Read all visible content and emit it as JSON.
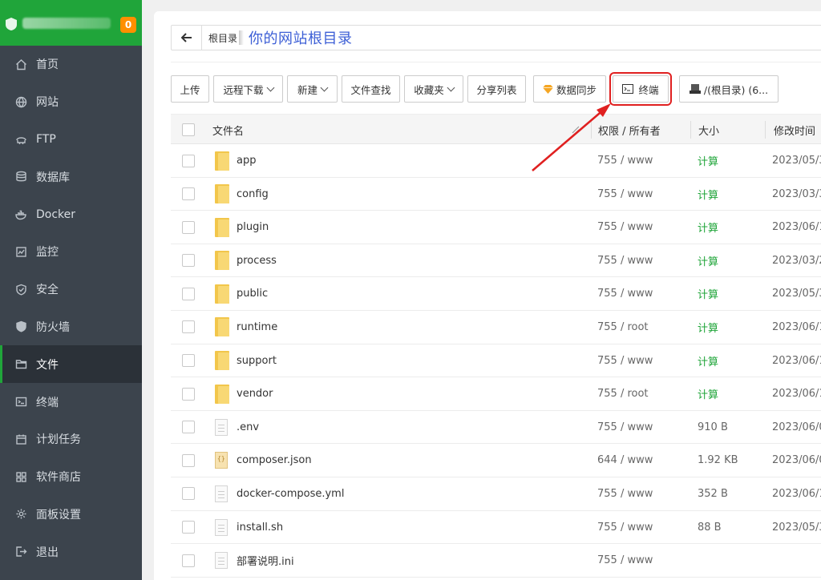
{
  "sidebar": {
    "badge": "0",
    "items": [
      {
        "label": "首页",
        "icon": "home-icon"
      },
      {
        "label": "网站",
        "icon": "globe-icon"
      },
      {
        "label": "FTP",
        "icon": "ftp-icon"
      },
      {
        "label": "数据库",
        "icon": "database-icon"
      },
      {
        "label": "Docker",
        "icon": "docker-icon"
      },
      {
        "label": "监控",
        "icon": "monitor-icon"
      },
      {
        "label": "安全",
        "icon": "shield-icon"
      },
      {
        "label": "防火墙",
        "icon": "firewall-icon"
      },
      {
        "label": "文件",
        "icon": "folder-icon",
        "active": true
      },
      {
        "label": "终端",
        "icon": "terminal-icon"
      },
      {
        "label": "计划任务",
        "icon": "calendar-icon"
      },
      {
        "label": "软件商店",
        "icon": "apps-icon"
      },
      {
        "label": "面板设置",
        "icon": "gear-icon"
      },
      {
        "label": "退出",
        "icon": "logout-icon"
      }
    ]
  },
  "path": {
    "crumb": "根目录",
    "title": "你的网站根目录"
  },
  "toolbar": {
    "upload": "上传",
    "remote_download": "远程下载",
    "new": "新建",
    "file_search": "文件查找",
    "favorites": "收藏夹",
    "share_list": "分享列表",
    "data_sync": "数据同步",
    "terminal": "终端",
    "disk": "/(根目录) (6..."
  },
  "table": {
    "headers": {
      "name": "文件名",
      "perm": "权限 / 所有者",
      "size": "大小",
      "mtime": "修改时间"
    },
    "rows": [
      {
        "name": "app",
        "type": "folder",
        "perm": "755 / www",
        "size": "计算",
        "calc": true,
        "mtime": "2023/05/3"
      },
      {
        "name": "config",
        "type": "folder",
        "perm": "755 / www",
        "size": "计算",
        "calc": true,
        "mtime": "2023/03/3"
      },
      {
        "name": "plugin",
        "type": "folder",
        "perm": "755 / www",
        "size": "计算",
        "calc": true,
        "mtime": "2023/06/1"
      },
      {
        "name": "process",
        "type": "folder",
        "perm": "755 / www",
        "size": "计算",
        "calc": true,
        "mtime": "2023/03/2"
      },
      {
        "name": "public",
        "type": "folder",
        "perm": "755 / www",
        "size": "计算",
        "calc": true,
        "mtime": "2023/05/3"
      },
      {
        "name": "runtime",
        "type": "folder",
        "perm": "755 / root",
        "size": "计算",
        "calc": true,
        "mtime": "2023/06/1"
      },
      {
        "name": "support",
        "type": "folder",
        "perm": "755 / www",
        "size": "计算",
        "calc": true,
        "mtime": "2023/06/1"
      },
      {
        "name": "vendor",
        "type": "folder",
        "perm": "755 / root",
        "size": "计算",
        "calc": true,
        "mtime": "2023/06/1"
      },
      {
        "name": ".env",
        "type": "file",
        "perm": "755 / www",
        "size": "910 B",
        "calc": false,
        "mtime": "2023/06/0"
      },
      {
        "name": "composer.json",
        "type": "json",
        "perm": "644 / www",
        "size": "1.92 KB",
        "calc": false,
        "mtime": "2023/06/0"
      },
      {
        "name": "docker-compose.yml",
        "type": "file",
        "perm": "755 / www",
        "size": "352 B",
        "calc": false,
        "mtime": "2023/06/1"
      },
      {
        "name": "install.sh",
        "type": "file",
        "perm": "755 / www",
        "size": "88 B",
        "calc": false,
        "mtime": "2023/05/3"
      },
      {
        "name": "部署说明.ini",
        "type": "file",
        "perm": "755 / www",
        "size": "",
        "calc": false,
        "mtime": ""
      }
    ]
  },
  "colors": {
    "brand_green": "#20a53a",
    "sidebar_bg": "#3c444d",
    "badge_orange": "#ff8f00",
    "highlight_red": "#e02020",
    "title_blue": "#3d5fd6"
  }
}
